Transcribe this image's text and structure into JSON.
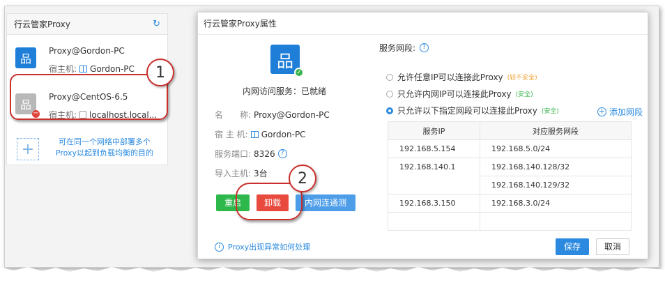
{
  "sidebar": {
    "title": "行云管家Proxy",
    "items": [
      {
        "name": "Proxy@Gordon-PC",
        "host_label": "宿主机:",
        "host": "Gordon-PC",
        "os_icon": "windows-icon"
      },
      {
        "name": "Proxy@CentOS-6.5",
        "host_label": "宿主机:",
        "host": "localhost.local...",
        "os_icon": "linux-icon"
      }
    ],
    "add_tip": "可在同一个网络中部署多个Proxy以起到负载均衡的目的"
  },
  "annotations": {
    "badge1": "1",
    "badge2": "2"
  },
  "modal": {
    "title": "行云管家Proxy属性",
    "service_status": "内网访问服务：已就绪",
    "info": {
      "name_key": "名　　称:",
      "name_val": "Proxy@Gordon-PC",
      "host_key": "宿 主 机:",
      "host_val": "Gordon-PC",
      "port_key": "服务端口:",
      "port_val": "8326",
      "import_key": "导入主机:",
      "import_val": "3台"
    },
    "buttons": {
      "restart": "重启",
      "uninstall": "卸载",
      "test": "内网连通测试",
      "save": "保存",
      "cancel": "取消"
    },
    "segment": {
      "label": "服务网段:",
      "options": [
        {
          "text": "允许任意IP可以连接此Proxy",
          "note": "(较不安全)",
          "selected": false
        },
        {
          "text": "只允许内网IP可以连接此Proxy",
          "note": "(安全)",
          "selected": false
        },
        {
          "text": "只允许以下指定网段可以连接此Proxy",
          "note": "(安全)",
          "selected": true
        }
      ],
      "add_label": "添加网段",
      "columns": [
        "服务IP",
        "对应服务网段"
      ],
      "rows": [
        [
          "192.168.5.154",
          "192.168.5.0/24"
        ],
        [
          "192.168.140.1",
          "192.168.140.128/32"
        ],
        [
          "",
          "192.168.140.129/32"
        ],
        [
          "192.168.3.150",
          "192.168.3.0/24"
        ],
        [
          "",
          ""
        ]
      ]
    },
    "footer_tip": "Proxy出现异常如何处理"
  },
  "colors": {
    "accent": "#2b8ae0",
    "success": "#2eb84b",
    "danger": "#e84a3e",
    "callout": "#c9302c"
  }
}
